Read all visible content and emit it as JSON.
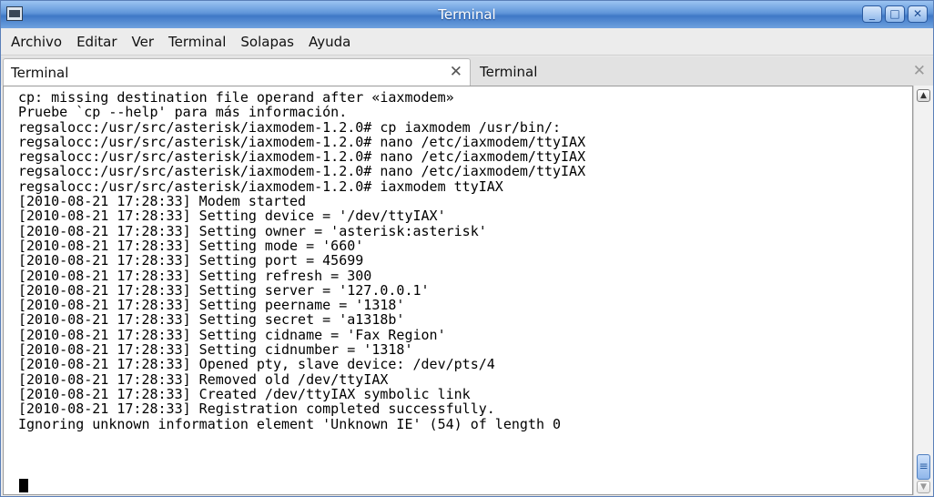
{
  "window": {
    "title": "Terminal",
    "buttons": {
      "minimize": "_",
      "maximize": "□",
      "close": "✕"
    }
  },
  "menubar": {
    "items": [
      "Archivo",
      "Editar",
      "Ver",
      "Terminal",
      "Solapas",
      "Ayuda"
    ]
  },
  "tabs": [
    {
      "label": "Terminal",
      "close": "✕"
    },
    {
      "label": "Terminal",
      "close": "✕"
    }
  ],
  "terminal": {
    "lines": "cp: missing destination file operand after «iaxmodem»\nPruebe `cp --help' para más información.\nregsalocc:/usr/src/asterisk/iaxmodem-1.2.0# cp iaxmodem /usr/bin/:\nregsalocc:/usr/src/asterisk/iaxmodem-1.2.0# nano /etc/iaxmodem/ttyIAX\nregsalocc:/usr/src/asterisk/iaxmodem-1.2.0# nano /etc/iaxmodem/ttyIAX\nregsalocc:/usr/src/asterisk/iaxmodem-1.2.0# nano /etc/iaxmodem/ttyIAX\nregsalocc:/usr/src/asterisk/iaxmodem-1.2.0# iaxmodem ttyIAX\n[2010-08-21 17:28:33] Modem started\n[2010-08-21 17:28:33] Setting device = '/dev/ttyIAX'\n[2010-08-21 17:28:33] Setting owner = 'asterisk:asterisk'\n[2010-08-21 17:28:33] Setting mode = '660'\n[2010-08-21 17:28:33] Setting port = 45699\n[2010-08-21 17:28:33] Setting refresh = 300\n[2010-08-21 17:28:33] Setting server = '127.0.0.1'\n[2010-08-21 17:28:33] Setting peername = '1318'\n[2010-08-21 17:28:33] Setting secret = 'a1318b'\n[2010-08-21 17:28:33] Setting cidname = 'Fax Region'\n[2010-08-21 17:28:33] Setting cidnumber = '1318'\n[2010-08-21 17:28:33] Opened pty, slave device: /dev/pts/4\n[2010-08-21 17:28:33] Removed old /dev/ttyIAX\n[2010-08-21 17:28:33] Created /dev/ttyIAX symbolic link\n[2010-08-21 17:28:33] Registration completed successfully.\nIgnoring unknown information element 'Unknown IE' (54) of length 0"
  },
  "scrollbar": {
    "up": "▲",
    "down": "▼",
    "thumb_grip": "≡"
  }
}
